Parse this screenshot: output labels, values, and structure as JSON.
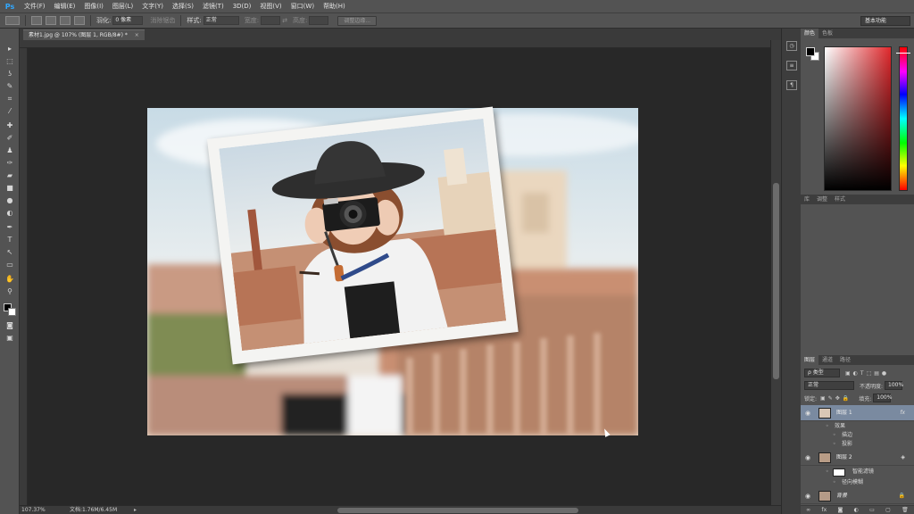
{
  "app": {
    "logo": "Ps"
  },
  "menu": [
    "文件(F)",
    "编辑(E)",
    "图像(I)",
    "图层(L)",
    "文字(Y)",
    "选择(S)",
    "滤镜(T)",
    "3D(D)",
    "视图(V)",
    "窗口(W)",
    "帮助(H)"
  ],
  "options": {
    "feather_label": "羽化:",
    "feather_value": "0 像素",
    "antialias_label": "消除锯齿",
    "style_label": "样式:",
    "style_value": "正常",
    "width_label": "宽度:",
    "height_label": "高度:",
    "refine_button": "调整边缘...",
    "workspace": "基本功能"
  },
  "document": {
    "tab_title": "素材1.jpg @ 107% (图层 1, RGB/8#) *"
  },
  "status": {
    "zoom": "107.37%",
    "doc_info": "文档:1.76M/6.45M"
  },
  "panels": {
    "color_tabs": [
      "颜色",
      "色板"
    ],
    "adjust_tabs": [
      "库",
      "调整",
      "样式"
    ],
    "layers_tabs": [
      "图层",
      "通道",
      "路径"
    ],
    "hue_color": "#e0282c"
  },
  "layers": {
    "kind_label": "ρ 类型",
    "blend_mode": "正常",
    "opacity_label": "不透明度:",
    "opacity_value": "100%",
    "lock_label": "锁定:",
    "fill_label": "填充:",
    "fill_value": "100%",
    "items": [
      {
        "name": "图层 1",
        "fx": "fx",
        "selected": true
      },
      {
        "name": "图层 2",
        "fx": "",
        "selected": false
      },
      {
        "name": "背景",
        "fx": "",
        "selected": false
      }
    ],
    "effects_label": "效果",
    "effect_stroke": "描边",
    "effect_shadow": "投影",
    "smart_filters": "智能滤镜",
    "radial_blur": "径向模糊"
  }
}
